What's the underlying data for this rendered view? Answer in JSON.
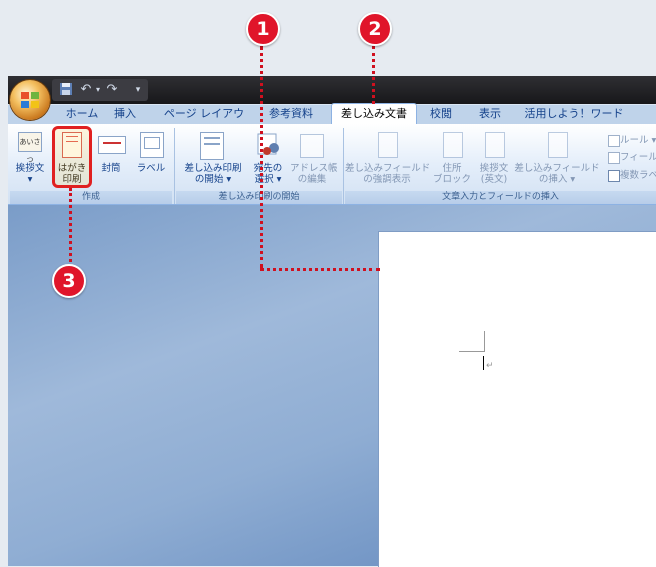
{
  "qat": {
    "save_icon": "save-icon",
    "undo_icon": "undo-icon",
    "redo_icon": "redo-icon",
    "customize_icon": "dropdown-icon"
  },
  "tabs": [
    {
      "label": "ホーム"
    },
    {
      "label": "挿入"
    },
    {
      "label": "ページ レイアウト"
    },
    {
      "label": "参考資料"
    },
    {
      "label": "差し込み文書",
      "active": true
    },
    {
      "label": "校閲"
    },
    {
      "label": "表示"
    },
    {
      "label": "活用しよう！ワード"
    }
  ],
  "ribbon": {
    "groups": {
      "create": {
        "label": "作成",
        "buttons": {
          "greeting": "挨拶文",
          "postcard_line1": "はがき",
          "postcard_line2": "印刷",
          "envelope": "封筒",
          "label": "ラベル",
          "greeting_icon_text": "あいさつ"
        }
      },
      "start_merge": {
        "label": "差し込み印刷の開始",
        "buttons": {
          "start_line1": "差し込み印刷",
          "start_line2": "の開始 ▾",
          "select_line1": "宛先の",
          "select_line2": "選択 ▾",
          "edit_line1": "アドレス帳",
          "edit_line2": "の編集"
        }
      },
      "insert_fields": {
        "label": "文章入力とフィールドの挿入",
        "buttons": {
          "highlight_line1": "差し込みフィールド",
          "highlight_line2": "の強調表示",
          "address_line1": "住所",
          "address_line2": "ブロック",
          "greet_line1": "挨拶文",
          "greet_line2": "(英文)",
          "insert_line1": "差し込みフィールド",
          "insert_line2": "の挿入 ▾",
          "rules": "ルール ▾",
          "match": "フィールド",
          "update": "複数ラベ"
        }
      }
    }
  },
  "callouts": [
    "1",
    "2",
    "3"
  ],
  "colors": {
    "callout": "#e0152a",
    "active_tab": "#ffffff",
    "ribbon_text": "#15428b"
  }
}
